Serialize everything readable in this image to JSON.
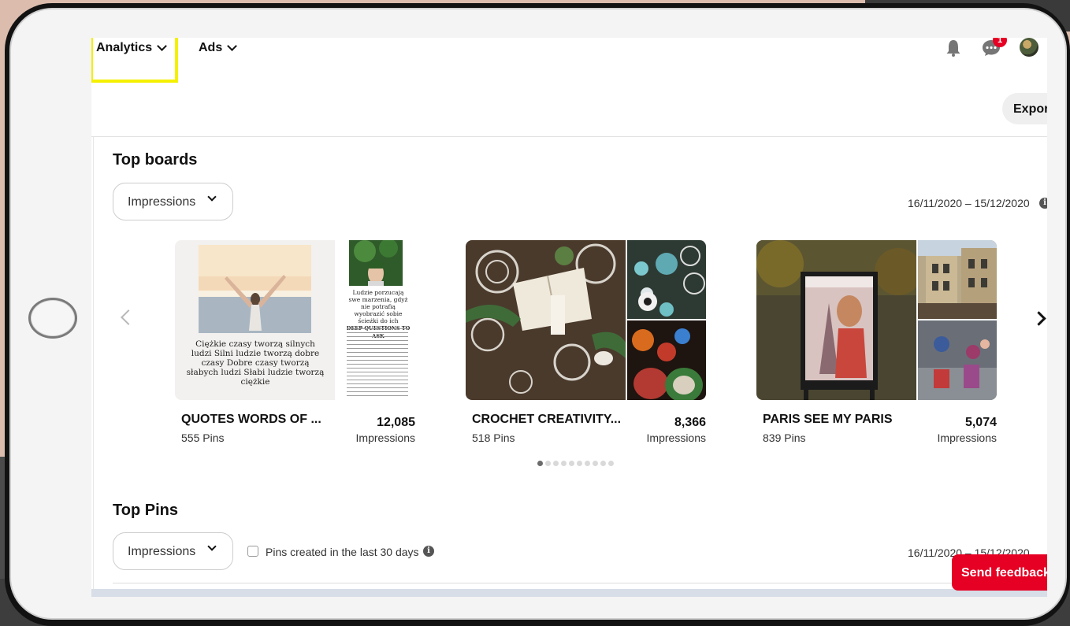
{
  "nav": {
    "analytics_label": "Analytics",
    "ads_label": "Ads",
    "notification_count": "1",
    "export_label": "Expor"
  },
  "top_boards": {
    "title": "Top boards",
    "metric_select": "Impressions",
    "date_range": "16/11/2020 – 15/12/2020",
    "boards": [
      {
        "name": "QUOTES WORDS OF ...",
        "pins": "555 Pins",
        "value": "12,085",
        "metric": "Impressions",
        "quote_lines": "Ciężkie czasy tworzą silnych ludzi Silni ludzie tworzą dobre czasy Dobre czasy tworzą słabych ludzi Słabi ludzie tworzą ciężkie",
        "side_quote": "Ludzie porzucają swe marzenia, gdyż nie potrafią wyobrazić sobie ścieżki do ich",
        "side_quote_head": "DEEP QUESTIONS TO ASK"
      },
      {
        "name": "CROCHET CREATIVITY...",
        "pins": "518 Pins",
        "value": "8,366",
        "metric": "Impressions"
      },
      {
        "name": "PARIS SEE MY PARIS",
        "pins": "839 Pins",
        "value": "5,074",
        "metric": "Impressions"
      }
    ],
    "carousel_page": 1,
    "carousel_pages": 10
  },
  "top_pins": {
    "title": "Top Pins",
    "metric_select": "Impressions",
    "checkbox_label": "Pins created in the last 30 days",
    "date_range": "16/11/2020 – 15/12/2020"
  },
  "feedback_label": "Send feedback",
  "colors": {
    "accent_red": "#e60023",
    "highlight_yellow": "#f4f000"
  },
  "icons": [
    "chevron-down-icon",
    "bell-icon",
    "chat-icon",
    "info-icon",
    "chevron-left-icon",
    "chevron-right-icon"
  ]
}
